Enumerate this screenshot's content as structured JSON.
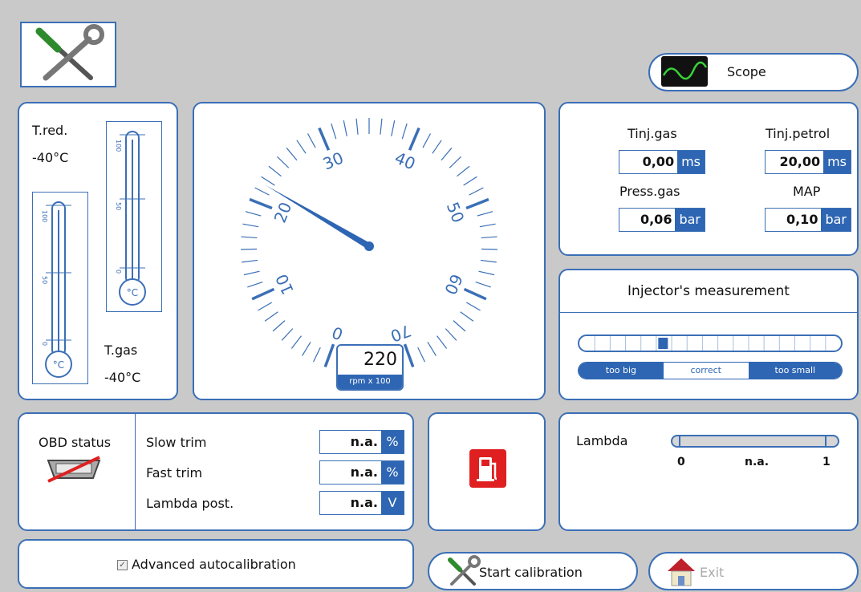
{
  "toolbar": {
    "tools_icon": "wrench-screwdriver-icon"
  },
  "scope_button": {
    "label": "Scope",
    "icon": "oscilloscope-icon"
  },
  "temps": {
    "t_red_label": "T.red.",
    "t_red_value": "-40°C",
    "t_gas_label": "T.gas",
    "t_gas_value": "-40°C",
    "therm_unit": "°C",
    "scale_labels": [
      "100",
      "50",
      "0"
    ]
  },
  "gauge": {
    "value": "220",
    "unit": "rpm x 100",
    "major_labels": [
      "0",
      "10",
      "20",
      "30",
      "40",
      "50",
      "60",
      "70"
    ],
    "needle_value": 0.22
  },
  "readings": {
    "tinj_gas": {
      "label": "Tinj.gas",
      "value": "0,00",
      "unit": "ms"
    },
    "tinj_petrol": {
      "label": "Tinj.petrol",
      "value": "20,00",
      "unit": "ms"
    },
    "press_gas": {
      "label": "Press.gas",
      "value": "0,06",
      "unit": "bar"
    },
    "map": {
      "label": "MAP",
      "value": "0,10",
      "unit": "bar"
    }
  },
  "injector": {
    "title": "Injector's measurement",
    "too_big": "too big",
    "correct": "correct",
    "too_small": "too small",
    "indicator_fraction": 0.32
  },
  "obd": {
    "status_label": "OBD status",
    "rows": [
      {
        "label": "Slow trim",
        "value": "n.a.",
        "unit": "%"
      },
      {
        "label": "Fast trim",
        "value": "n.a.",
        "unit": "%"
      },
      {
        "label": "Lambda post.",
        "value": "n.a.",
        "unit": "V"
      }
    ]
  },
  "fuel": {
    "icon": "fuel-pump-icon",
    "color": "#e02020"
  },
  "lambda": {
    "label": "Lambda",
    "min": "0",
    "value": "n.a.",
    "max": "1"
  },
  "autocal": {
    "label": "Advanced autocalibration",
    "checked": true
  },
  "start_button": {
    "label": "Start calibration"
  },
  "exit_button": {
    "label": "Exit"
  },
  "colors": {
    "accent": "#2e66b3",
    "border": "#3b6fb6",
    "background": "#c9c9c9"
  }
}
